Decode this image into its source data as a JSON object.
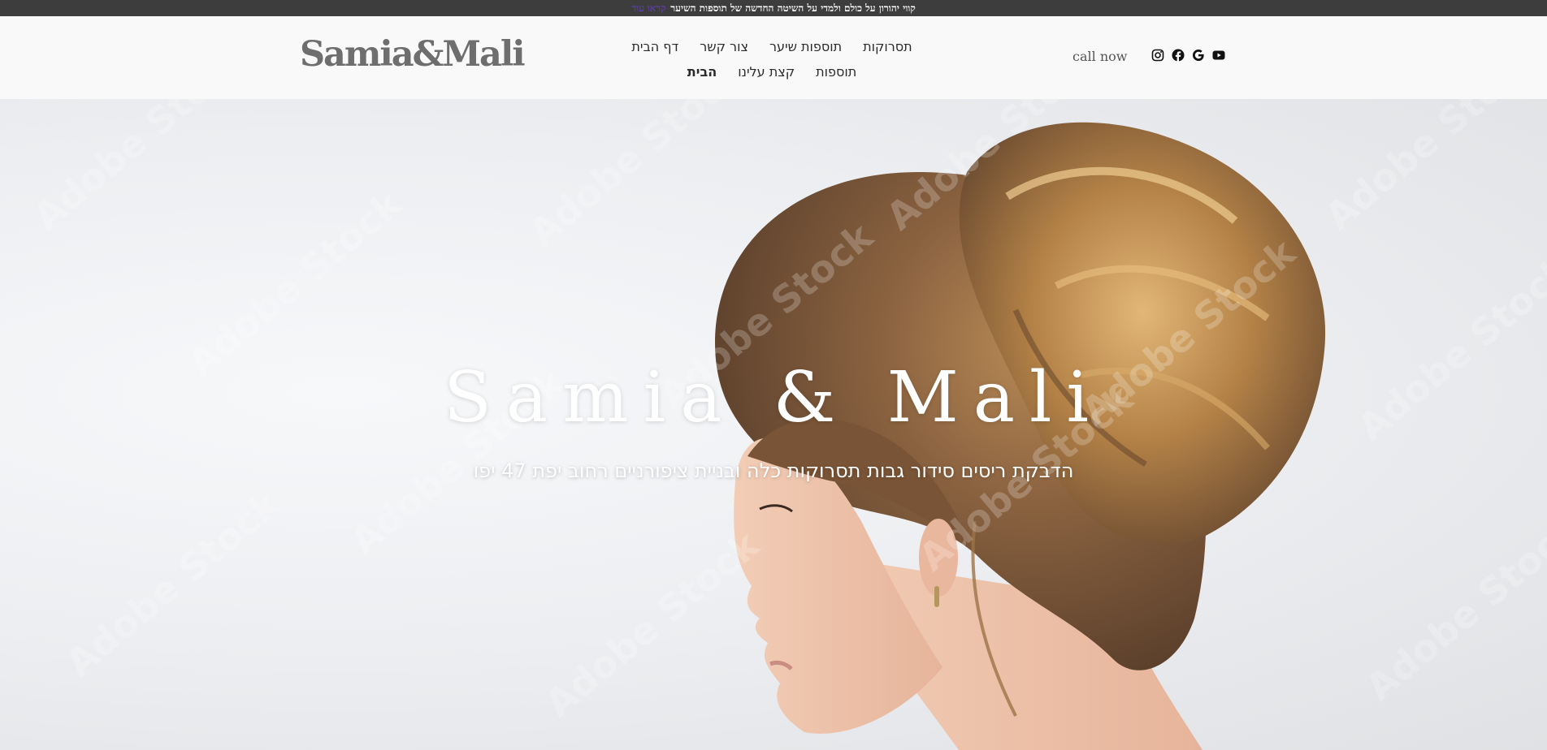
{
  "announcement": {
    "text": "קווי יהורון על כולם ולמדי על השיטה החדשה של תוספות השיער",
    "link": "קראו עוד"
  },
  "header": {
    "logo": "Samia&Mali",
    "nav_row1": [
      "תסרוקות",
      "תוספות שיער",
      "צור קשר",
      "דף הבית"
    ],
    "nav_row2": [
      "תוספות",
      "קצת עלינו",
      "הבית"
    ],
    "call_label": "call now",
    "social_icons": [
      "instagram-icon",
      "facebook-icon",
      "google-icon",
      "youtube-icon"
    ]
  },
  "hero": {
    "title": "Samia & Mali",
    "subtitle": "הדבקת ריסים סידור גבות תסרוקות כלה ובניית ציפורניים רחוב יפת 47 יפו",
    "watermark": "Adobe Stock"
  },
  "colors": {
    "announcement_bg": "#3d3d3d",
    "header_bg": "#f9f9f9",
    "logo": "#6e6e6e",
    "link_accent": "#6a3cc9",
    "hero_text": "#ffffff"
  }
}
